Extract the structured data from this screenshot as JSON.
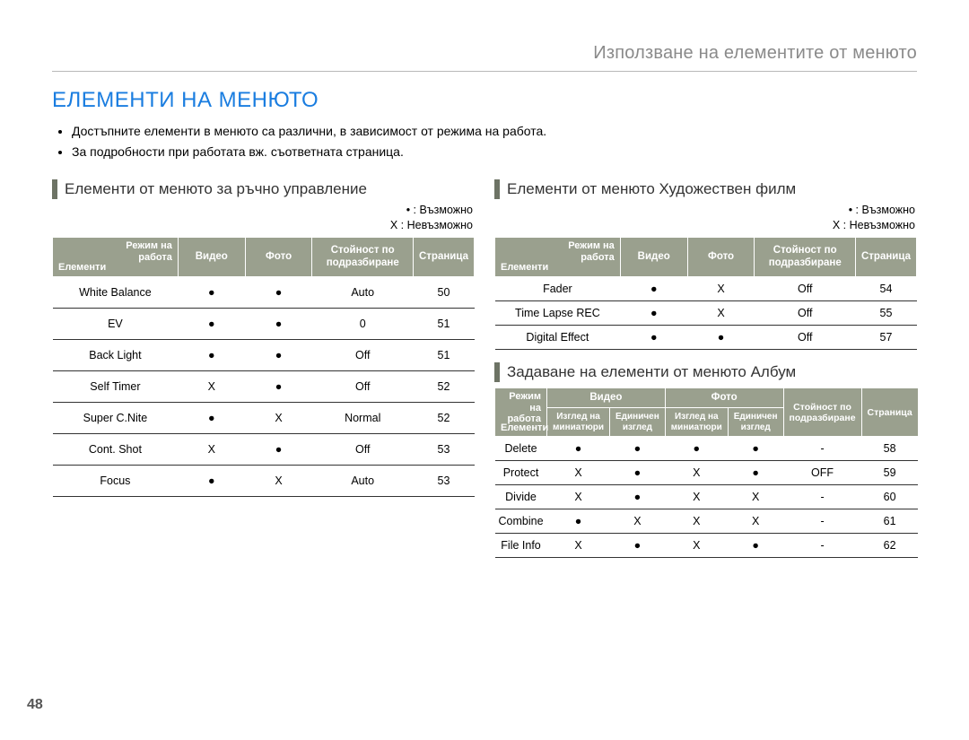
{
  "breadcrumb": "Използване на елементите от менюто",
  "title": "ЕЛЕМЕНТИ НА МЕНЮТО",
  "intro_bullets": [
    "Достъпните елементи в менюто са различни, в зависимост от режима на работа.",
    "За подробности при работата вж. съответната страница."
  ],
  "legend": {
    "possible": "• : Възможно",
    "impossible": "X : Невъзможно"
  },
  "header_labels": {
    "mode_top": "Режим на",
    "mode_bottom": "работа",
    "items": "Елементи",
    "video": "Видео",
    "photo": "Фото",
    "default": "Стойност по подразбиране",
    "page": "Страница",
    "thumb_view": "Изглед на миниатюри",
    "single_view": "Единичен изглед"
  },
  "manual": {
    "title": "Елементи от менюто за ръчно управление",
    "rows": [
      {
        "name": "White Balance",
        "video": "●",
        "photo": "●",
        "default": "Auto",
        "page": "50"
      },
      {
        "name": "EV",
        "video": "●",
        "photo": "●",
        "default": "0",
        "page": "51"
      },
      {
        "name": "Back Light",
        "video": "●",
        "photo": "●",
        "default": "Off",
        "page": "51"
      },
      {
        "name": "Self Timer",
        "video": "X",
        "photo": "●",
        "default": "Off",
        "page": "52"
      },
      {
        "name": "Super C.Nite",
        "video": "●",
        "photo": "X",
        "default": "Normal",
        "page": "52"
      },
      {
        "name": "Cont. Shot",
        "video": "X",
        "photo": "●",
        "default": "Off",
        "page": "53"
      },
      {
        "name": "Focus",
        "video": "●",
        "photo": "X",
        "default": "Auto",
        "page": "53"
      }
    ]
  },
  "film": {
    "title": "Елементи от менюто Художествен филм",
    "rows": [
      {
        "name": "Fader",
        "video": "●",
        "photo": "X",
        "default": "Off",
        "page": "54"
      },
      {
        "name": "Time Lapse REC",
        "video": "●",
        "photo": "X",
        "default": "Off",
        "page": "55"
      },
      {
        "name": "Digital Effect",
        "video": "●",
        "photo": "●",
        "default": "Off",
        "page": "57"
      }
    ]
  },
  "album": {
    "title": "Задаване на елементи от менюто Албум",
    "rows": [
      {
        "name": "Delete",
        "vthumb": "●",
        "vsingle": "●",
        "pthumb": "●",
        "psingle": "●",
        "default": "-",
        "page": "58"
      },
      {
        "name": "Protect",
        "vthumb": "X",
        "vsingle": "●",
        "pthumb": "X",
        "psingle": "●",
        "default": "OFF",
        "page": "59"
      },
      {
        "name": "Divide",
        "vthumb": "X",
        "vsingle": "●",
        "pthumb": "X",
        "psingle": "X",
        "default": "-",
        "page": "60"
      },
      {
        "name": "Combine",
        "vthumb": "●",
        "vsingle": "X",
        "pthumb": "X",
        "psingle": "X",
        "default": "-",
        "page": "61"
      },
      {
        "name": "File Info",
        "vthumb": "X",
        "vsingle": "●",
        "pthumb": "X",
        "psingle": "●",
        "default": "-",
        "page": "62"
      }
    ]
  },
  "page_number": "48"
}
